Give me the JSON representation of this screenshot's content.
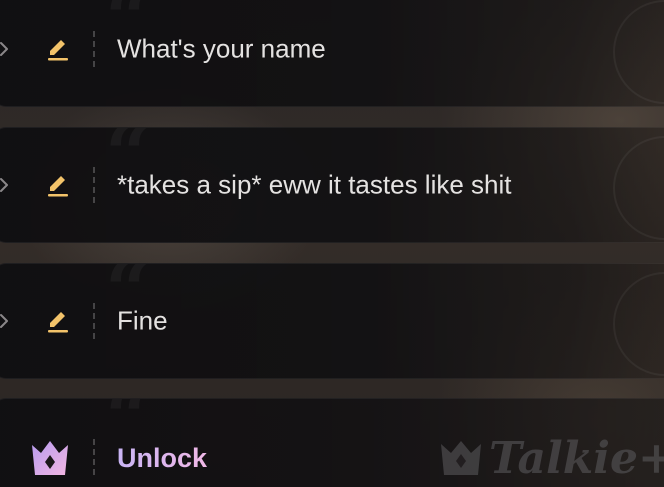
{
  "messages": [
    {
      "text": "What's your name",
      "chevron_icon": "chevron-right-icon",
      "edit_icon": "edit-icon"
    },
    {
      "text": "*takes a sip* eww it tastes like shit",
      "chevron_icon": "chevron-right-icon",
      "edit_icon": "edit-icon"
    },
    {
      "text": "Fine",
      "chevron_icon": "chevron-right-icon",
      "edit_icon": "edit-icon"
    }
  ],
  "unlock": {
    "label": "Unlock",
    "icon": "crown-icon"
  },
  "watermark": {
    "text": "Talkie+"
  },
  "colors": {
    "edit_icon": "#f3c36a",
    "card_bg": "#121114",
    "message_text": "#e4e2e1",
    "unlock_gradient_start": "#c9b4f5",
    "unlock_gradient_end": "#f0b8e6"
  }
}
